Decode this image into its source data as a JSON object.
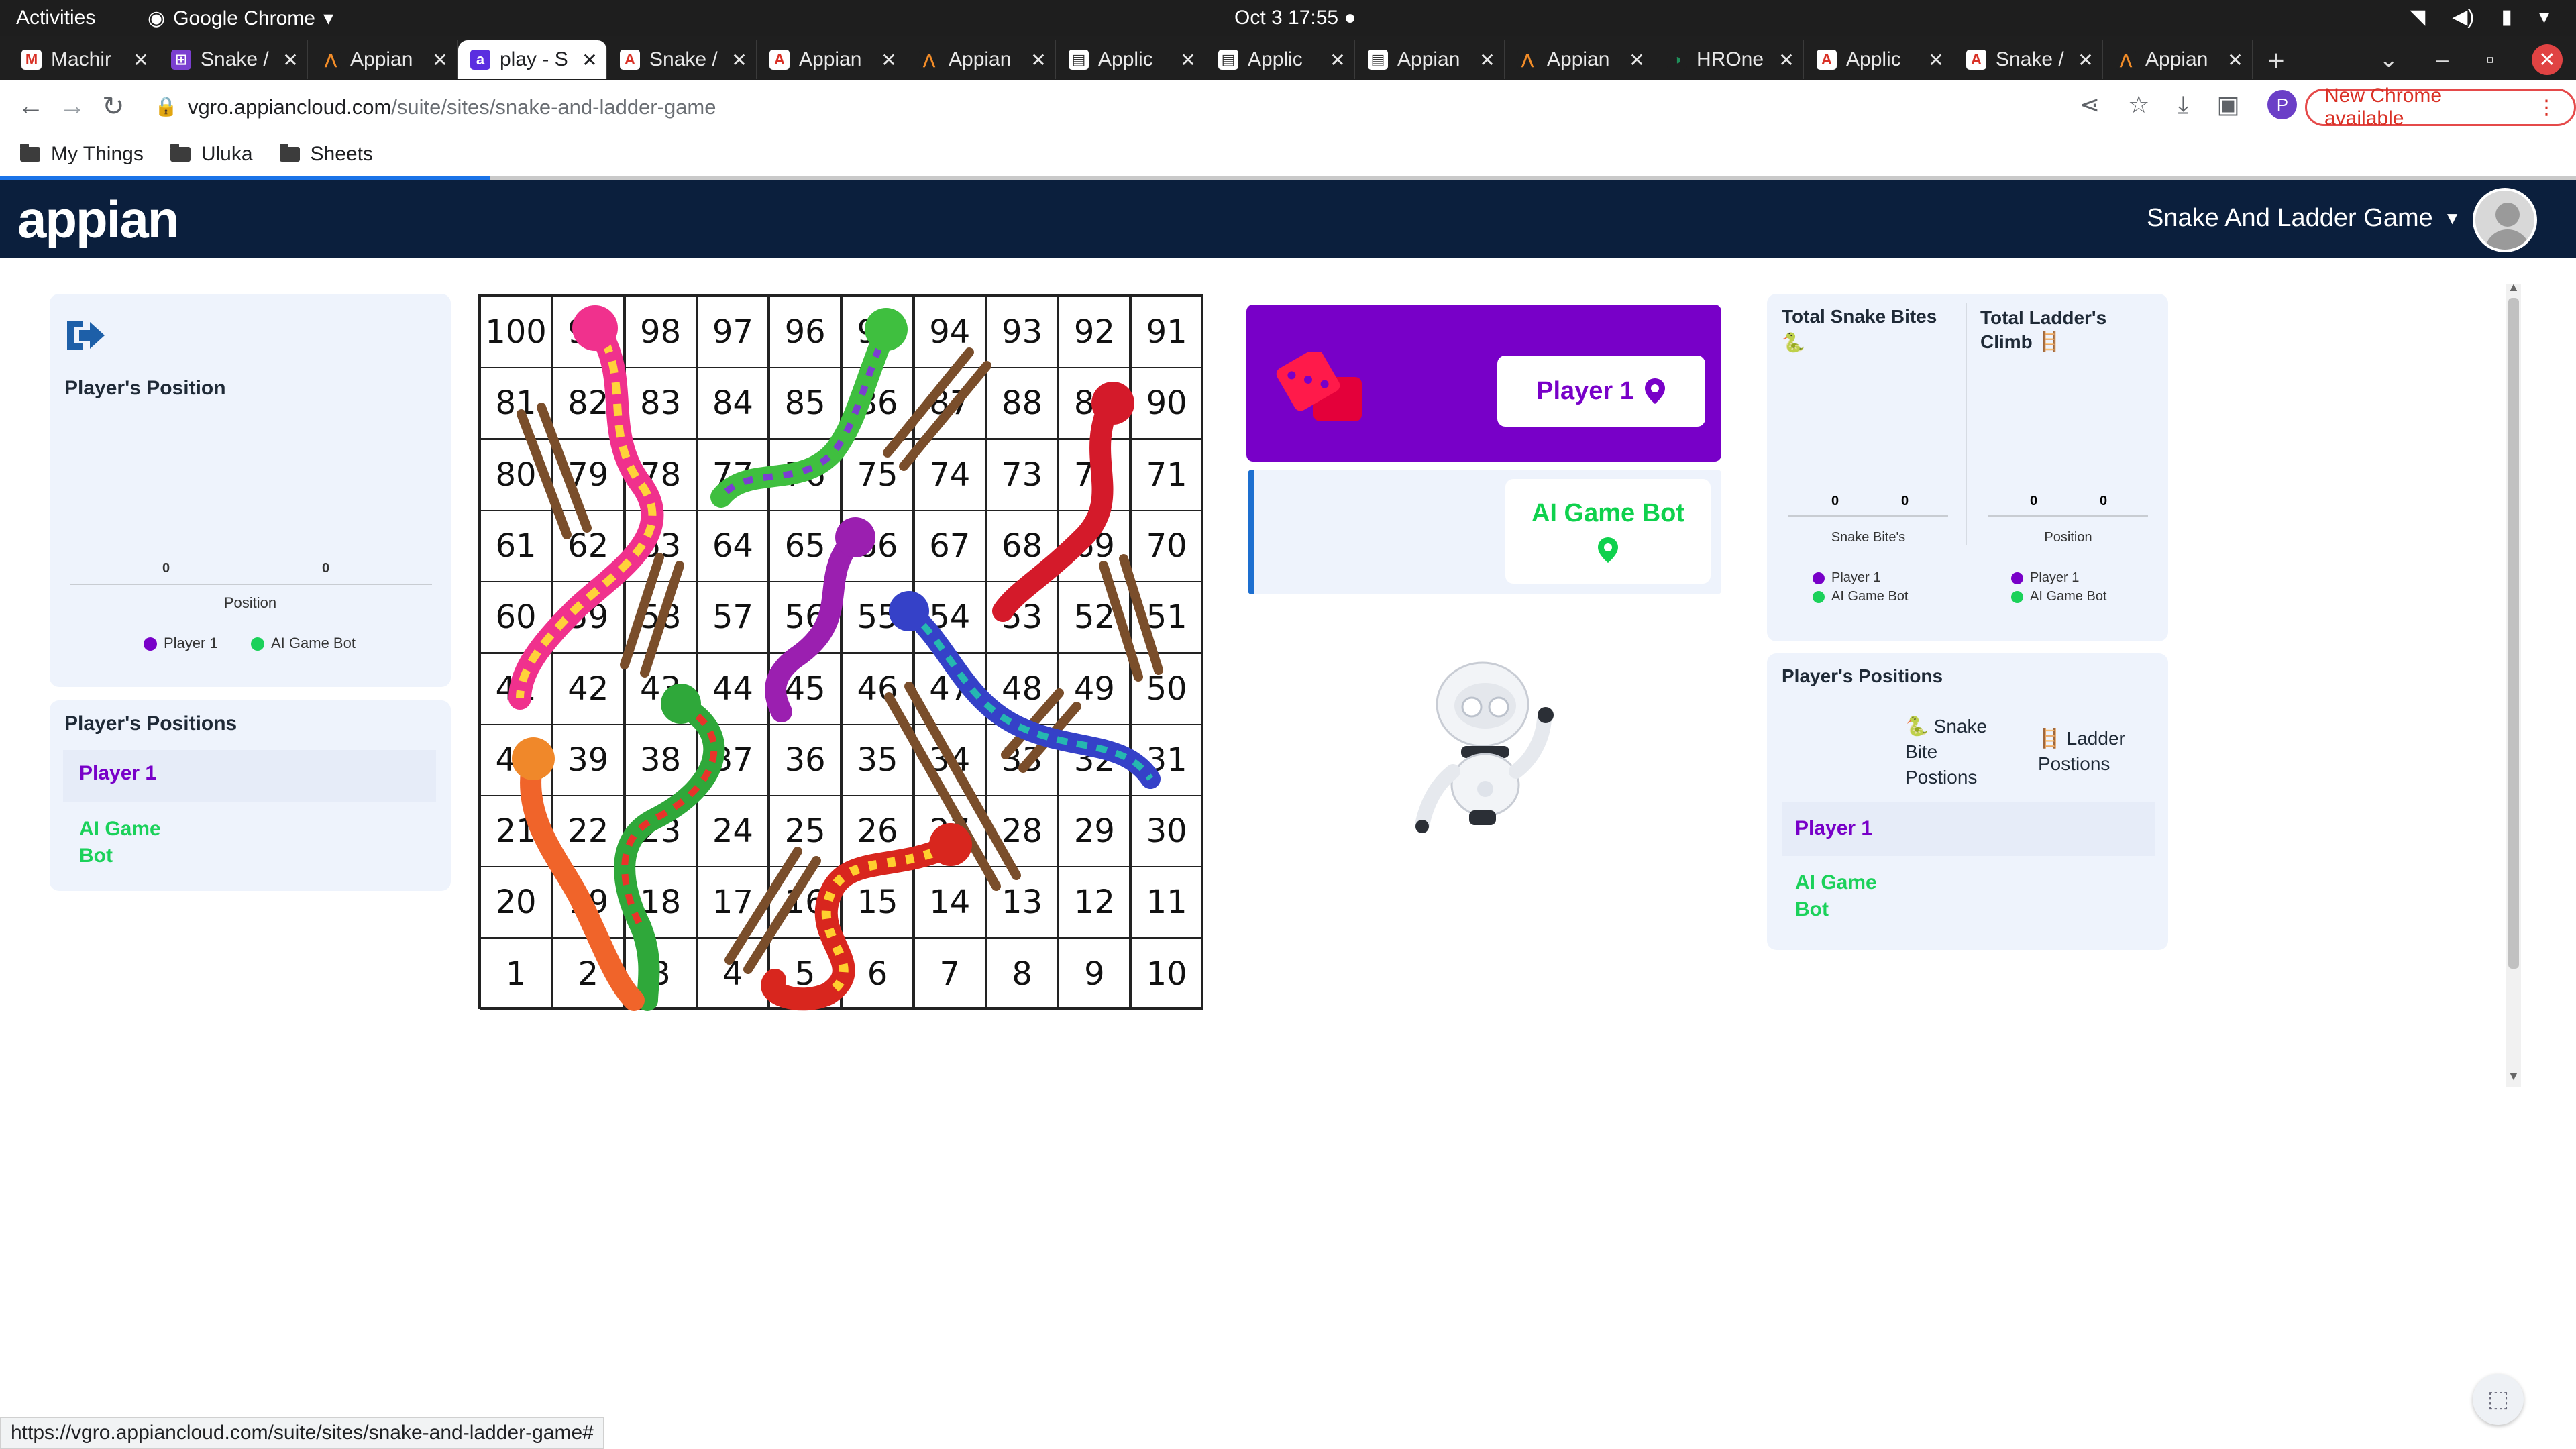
{
  "os": {
    "activities": "Activities",
    "app_name": "Google Chrome",
    "clock": "Oct 3  17:55"
  },
  "tabs": [
    {
      "title": "Machir",
      "favicon": "gmail-icon"
    },
    {
      "title": "Snake /",
      "favicon": "app-grid-icon"
    },
    {
      "title": "Appian",
      "favicon": "appian-icon"
    },
    {
      "title": "play - S",
      "favicon": "appian-a-icon",
      "active": true
    },
    {
      "title": "Snake /",
      "favicon": "appian-red-icon"
    },
    {
      "title": "Appian",
      "favicon": "appian-red-icon"
    },
    {
      "title": "Appian",
      "favicon": "appian-icon"
    },
    {
      "title": "Applic",
      "favicon": "doc-icon"
    },
    {
      "title": "Applic",
      "favicon": "doc-icon"
    },
    {
      "title": "Appian",
      "favicon": "doc-icon"
    },
    {
      "title": "Appian",
      "favicon": "appian-icon"
    },
    {
      "title": "HROne",
      "favicon": "hrone-icon"
    },
    {
      "title": "Applic",
      "favicon": "appian-red-icon"
    },
    {
      "title": "Snake /",
      "favicon": "appian-red-icon"
    },
    {
      "title": "Appian",
      "favicon": "appian-icon"
    }
  ],
  "browser": {
    "url_host": "vgro.appiancloud.com",
    "url_path": "/suite/sites/snake-and-ladder-game",
    "new_chrome": "New Chrome available",
    "profile_initial": "P",
    "status_url": "https://vgro.appiancloud.com/suite/sites/snake-and-ladder-game#"
  },
  "bookmarks": [
    "My Things",
    "Uluka",
    "Sheets"
  ],
  "appian": {
    "logo": "appian",
    "site_title": "Snake And Ladder Game"
  },
  "left_panel": {
    "title": "Player's Position",
    "values": [
      "0",
      "0"
    ],
    "axis_label": "Position",
    "legend": [
      {
        "name": "Player 1",
        "color": "#7800c8"
      },
      {
        "name": "AI Game Bot",
        "color": "#1bd15a"
      }
    ]
  },
  "left_positions": {
    "title": "Player's Positions",
    "player1": "Player 1",
    "bot": "AI Game Bot"
  },
  "players": {
    "active_label": "Player 1",
    "bot_label": "AI Game Bot"
  },
  "stats": {
    "snake_title": "Total Snake Bites",
    "ladder_title": "Total Ladder's Climb",
    "snake_values": [
      "0",
      "0"
    ],
    "ladder_values": [
      "0",
      "0"
    ],
    "snake_axis": "Snake Bite's",
    "ladder_axis": "Position",
    "legend_p1": "Player 1",
    "legend_bot": "AI Game Bot"
  },
  "right_positions": {
    "title": "Player's Positions",
    "snake_col": "Snake Bite Postions",
    "ladder_col": "Ladder Postions",
    "player1": "Player 1",
    "bot": "AI Game Bot"
  },
  "board_numbers": [
    [
      100,
      99,
      98,
      97,
      96,
      95,
      94,
      93,
      92,
      91
    ],
    [
      81,
      82,
      83,
      84,
      85,
      86,
      87,
      88,
      89,
      90
    ],
    [
      80,
      79,
      78,
      77,
      76,
      75,
      74,
      73,
      72,
      71
    ],
    [
      61,
      62,
      63,
      64,
      65,
      66,
      67,
      68,
      69,
      70
    ],
    [
      60,
      59,
      58,
      57,
      56,
      55,
      54,
      53,
      52,
      51
    ],
    [
      41,
      42,
      43,
      44,
      45,
      46,
      47,
      48,
      49,
      50
    ],
    [
      40,
      39,
      38,
      37,
      36,
      35,
      34,
      33,
      32,
      31
    ],
    [
      21,
      22,
      23,
      24,
      25,
      26,
      27,
      28,
      29,
      30
    ],
    [
      20,
      19,
      18,
      17,
      16,
      15,
      14,
      13,
      12,
      11
    ],
    [
      1,
      2,
      3,
      4,
      5,
      6,
      7,
      8,
      9,
      10
    ]
  ],
  "colors": {
    "player1": "#7800c8",
    "bot": "#1bd15a",
    "appian_nav": "#0b1f3d",
    "card_bg": "#eef3fc"
  }
}
